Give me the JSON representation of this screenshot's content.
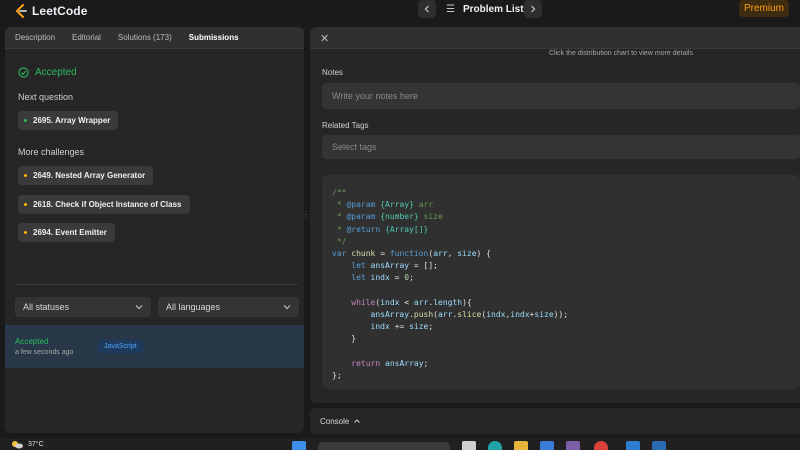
{
  "app": {
    "logo_text": "LeetCode"
  },
  "topbar": {
    "prev_icon": "chevron-left-icon",
    "next_icon": "chevron-right-icon",
    "problem_list_label": "Problem List",
    "premium_label": "Premium"
  },
  "left_tabs": [
    {
      "label": "Description"
    },
    {
      "label": "Editorial"
    },
    {
      "label": "Solutions (173)"
    },
    {
      "label": "Submissions",
      "active": true
    }
  ],
  "result": {
    "status": "Accepted",
    "next_question_label": "Next question",
    "next_question": "2695. Array Wrapper",
    "more_challenges_label": "More challenges",
    "challenges": [
      "2649. Nested Array Generator",
      "2618. Check if Object Instance of Class",
      "2694. Event Emitter"
    ]
  },
  "filters": {
    "status_value": "All statuses",
    "language_value": "All languages"
  },
  "submission": {
    "status": "Accepted",
    "time": "a few seconds ago",
    "language": "JavaScript"
  },
  "details": {
    "hint": "Click the distribution chart to view more details",
    "notes_label": "Notes",
    "notes_placeholder": "Write your notes here",
    "tags_label": "Related Tags",
    "tags_placeholder": "Select tags"
  },
  "console": {
    "label": "Console"
  },
  "taskbar": {
    "temperature": "37°C"
  },
  "colors": {
    "accent_green": "#2cbb5d",
    "premium_orange": "#ffa116",
    "bullet_yellow": "#ffb800",
    "js_blue": "#4fa3ff"
  }
}
